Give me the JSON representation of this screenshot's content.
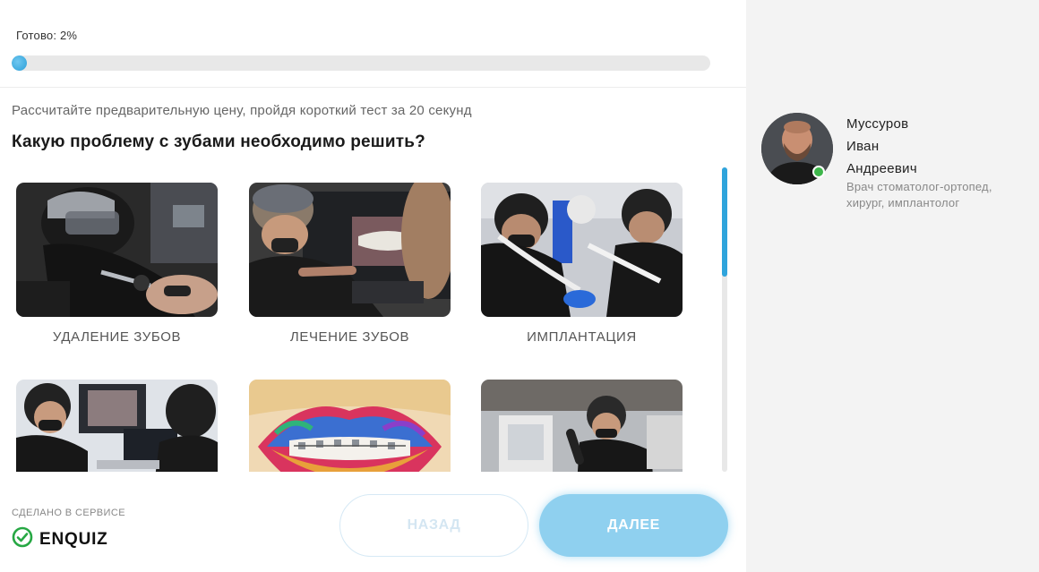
{
  "progress": {
    "label": "Готово: 2%",
    "value_percent": 2
  },
  "quiz": {
    "subtitle": "Рассчитайте предварительную цену, пройдя короткий тест за 20 секунд",
    "question": "Какую проблему с зубами необходимо решить?",
    "options": [
      {
        "label": "УДАЛЕНИЕ ЗУБОВ"
      },
      {
        "label": "ЛЕЧЕНИЕ ЗУБОВ"
      },
      {
        "label": "ИМПЛАНТАЦИЯ"
      },
      {
        "label": ""
      },
      {
        "label": ""
      },
      {
        "label": ""
      }
    ]
  },
  "footer": {
    "made_in": "СДЕЛАНО В СЕРВИСЕ",
    "brand": "ENQUIZ",
    "back_label": "НАЗАД",
    "next_label": "ДАЛЕЕ"
  },
  "doctor": {
    "name_line1": "Муссуров",
    "name_line2": "Иван",
    "name_line3": "Андреевич",
    "role_line1": "Врач стоматолог-ортопед,",
    "role_line2": "хирург, имплантолог"
  },
  "colors": {
    "accent": "#2fa4dc",
    "next_button": "#8fd0ef",
    "online": "#3db64a",
    "brand_check": "#27a844"
  }
}
